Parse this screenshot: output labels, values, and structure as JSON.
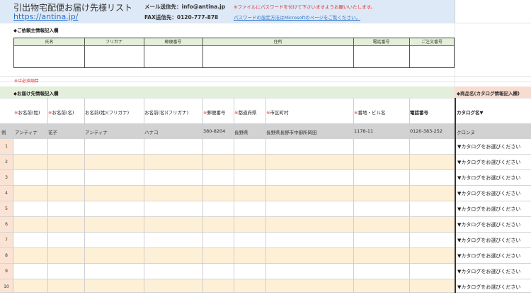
{
  "header": {
    "title": "引出物宅配便お届け先様リスト",
    "link": "https://antina.jp/",
    "mail_label": "メール送信先：info@antina.jp",
    "fax_label": "FAX送信先：0120-777-878",
    "password_note": "※ファイルにパスワードを付けて下さいますようお願いいたします。",
    "password_link": "パスワードの設定方法はMicrosoftのページをご覧ください。"
  },
  "client_section": {
    "label": "◆ご依頼主情報記入欄",
    "columns": [
      "氏名",
      "フリガナ",
      "郵便番号",
      "住所",
      "電話番号",
      "ご注文番号"
    ]
  },
  "required_note": "※は必須項目",
  "delivery_section": {
    "label": "◆お届け先情報記入欄",
    "catalog_label": "◆商品名(カタログ情報記入欄)",
    "columns": [
      {
        "text": "お名前(姓)",
        "required": true
      },
      {
        "text": "お名前(名)",
        "required": true
      },
      {
        "text": "お名前(姓)(フリガナ)",
        "required": false
      },
      {
        "text": "お名前(名)(フリガナ)",
        "required": false
      },
      {
        "text": "郵便番号",
        "required": true
      },
      {
        "text": "都道府県",
        "required": true
      },
      {
        "text": "市区町村",
        "required": true
      },
      {
        "text": "番地・ビル名",
        "required": true
      },
      {
        "text": "電話番号",
        "required": false
      },
      {
        "text": "カタログ名▼",
        "required": false
      }
    ]
  },
  "example_row": {
    "label": "例",
    "values": [
      "アンティナ",
      "花子",
      "アンティナ",
      "ハナコ",
      "380-8204",
      "長野県",
      "長野県長野市中御所岡田",
      "1178-11",
      "0120-383-252",
      "クロンヌ"
    ]
  },
  "rows": [
    {
      "num": "1",
      "catalog": "▼カタログをお選びください"
    },
    {
      "num": "2",
      "catalog": "▼カタログをお選びください"
    },
    {
      "num": "3",
      "catalog": "▼カタログをお選びください"
    },
    {
      "num": "4",
      "catalog": "▼カタログをお選びください"
    },
    {
      "num": "5",
      "catalog": "▼カタログをお選びください"
    },
    {
      "num": "6",
      "catalog": "▼カタログをお選びください"
    },
    {
      "num": "7",
      "catalog": "▼カタログをお選びください"
    },
    {
      "num": "8",
      "catalog": "▼カタログをお選びください"
    },
    {
      "num": "9",
      "catalog": "▼カタログをお選びください"
    },
    {
      "num": "10",
      "catalog": "▼カタログをお選びください"
    }
  ],
  "colors": {
    "header_band": "#dde9f6",
    "section_green": "#e3efda",
    "catalog_pink": "#f8dcd0",
    "row_alt": "#fdf0d6",
    "required_red": "#e03030",
    "link_blue": "#2a6fc7"
  }
}
